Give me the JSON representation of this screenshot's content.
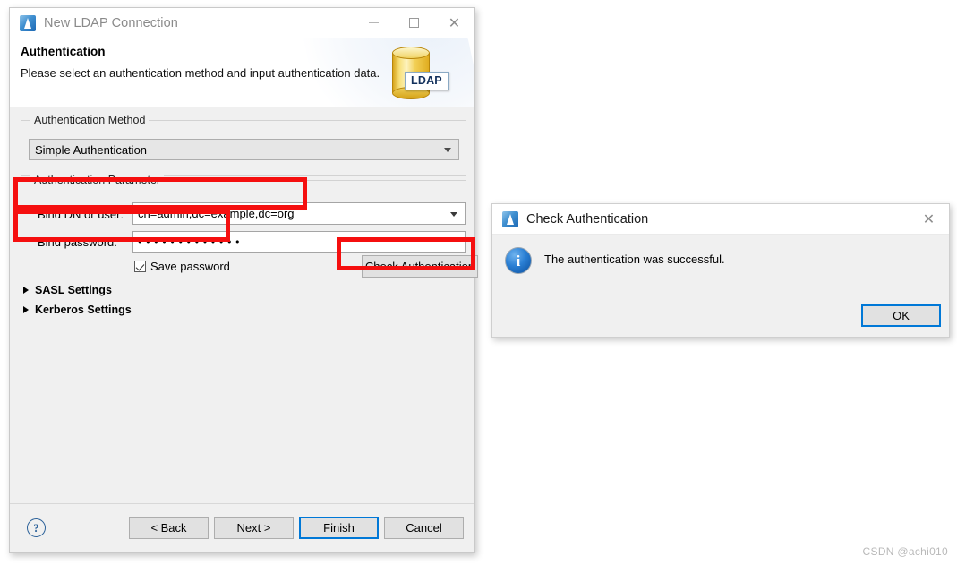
{
  "wizard": {
    "title": "New LDAP Connection",
    "icon": "ldap-connection-icon",
    "window_controls": {
      "minimize": "minimize-icon",
      "maximize": "maximize-icon",
      "close": "close-icon"
    },
    "header": {
      "heading": "Authentication",
      "description": "Please select an authentication method and input authentication data.",
      "banner_icon_label": "LDAP"
    },
    "auth_method_group": {
      "label": "Authentication Method",
      "selected": "Simple Authentication"
    },
    "auth_param_group": {
      "label": "Authentication Parameter",
      "bind_dn_label": "Bind DN or user:",
      "bind_dn_value": "cn=admin,dc=example,dc=org",
      "bind_password_label": "Bind password:",
      "bind_password_masked": "•••••••••••••",
      "save_password_label": "Save password",
      "save_password_checked": true,
      "check_auth_label": "Check Authentication"
    },
    "sasl_settings_label": "SASL Settings",
    "kerberos_settings_label": "Kerberos Settings",
    "footer": {
      "help_label": "?",
      "back_label": "< Back",
      "next_label": "Next >",
      "finish_label": "Finish",
      "cancel_label": "Cancel"
    }
  },
  "message_dialog": {
    "title": "Check Authentication",
    "icon": "ldap-connection-icon",
    "close_label": "✕",
    "info_icon": "info-icon",
    "message": "The authentication was successful.",
    "ok_label": "OK"
  },
  "watermark": "CSDN @achi010",
  "colors": {
    "accent": "#0078D7",
    "annotation": "#F50F0F",
    "dialog_background": "#F0F0F0",
    "ldap_yellow": "#F0D363"
  }
}
